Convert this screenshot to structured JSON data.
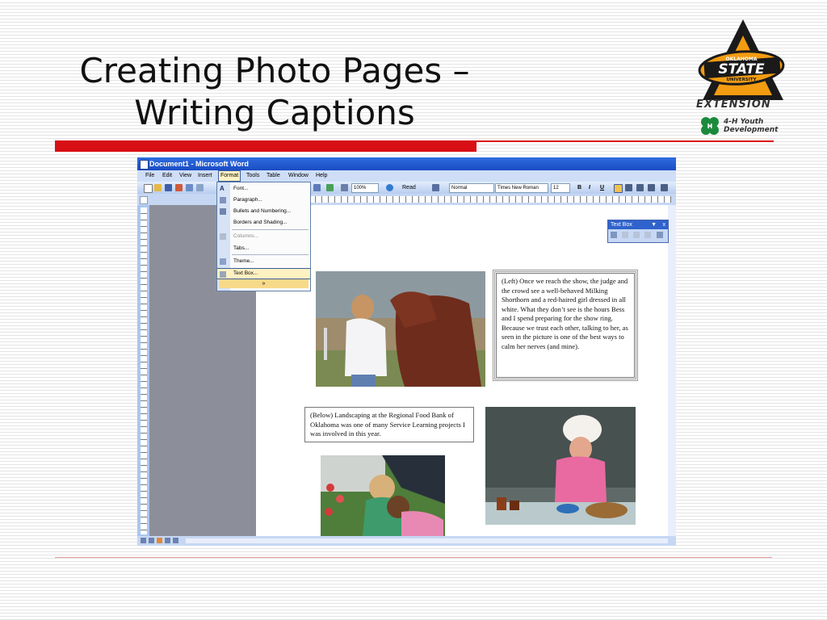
{
  "slide": {
    "title_line1": "Creating Photo Pages –",
    "title_line2": "Writing Captions"
  },
  "logo": {
    "university_top": "OKLAHOMA",
    "university_main": "STATE",
    "university_bottom": "UNIVERSITY",
    "extension": "EXTENSION",
    "fourh_line1": "4-H Youth",
    "fourh_line2": "Development"
  },
  "word": {
    "window_title": "Document1 - Microsoft Word",
    "menu": [
      "File",
      "Edit",
      "View",
      "Insert",
      "Format",
      "Tools",
      "Table",
      "Window",
      "Help"
    ],
    "zoom": "100%",
    "read_button": "Read",
    "style": "Normal",
    "font": "Times New Roman",
    "font_size": "12",
    "bold": "B",
    "italic": "I",
    "underline": "U"
  },
  "format_menu": {
    "items": [
      {
        "label": "Font...",
        "disabled": false
      },
      {
        "label": "Paragraph...",
        "disabled": false
      },
      {
        "label": "Bullets and Numbering...",
        "disabled": false
      },
      {
        "label": "Borders and Shading...",
        "disabled": false
      },
      {
        "label": "Columns...",
        "disabled": true
      },
      {
        "label": "Tabs...",
        "disabled": false
      },
      {
        "label": "Theme...",
        "disabled": false
      },
      {
        "label": "Text Box...",
        "disabled": false,
        "highlighted": true
      }
    ],
    "expand": "»"
  },
  "textbox_toolbar": {
    "title": "Text Box",
    "close": "x",
    "options": "▼"
  },
  "captions": {
    "left": "(Left) Once we reach the show, the judge and the crowd see a well-behaved Milking Shorthorn and a red-haired girl dressed in all white. What they don’t see is the hours Bess and I spend preparing for the show ring. Because we trust each other, talking to her, as seen in the picture is one of the best ways to calm her nerves (and mine).",
    "below": "(Below) Landscaping at the Regional Food Bank of Oklahoma was one of many Service Learning projects I was involved in this year."
  },
  "colors": {
    "accent_red": "#d80f15",
    "osu_orange": "#f39c12",
    "fourh_green": "#1c8a3c"
  }
}
